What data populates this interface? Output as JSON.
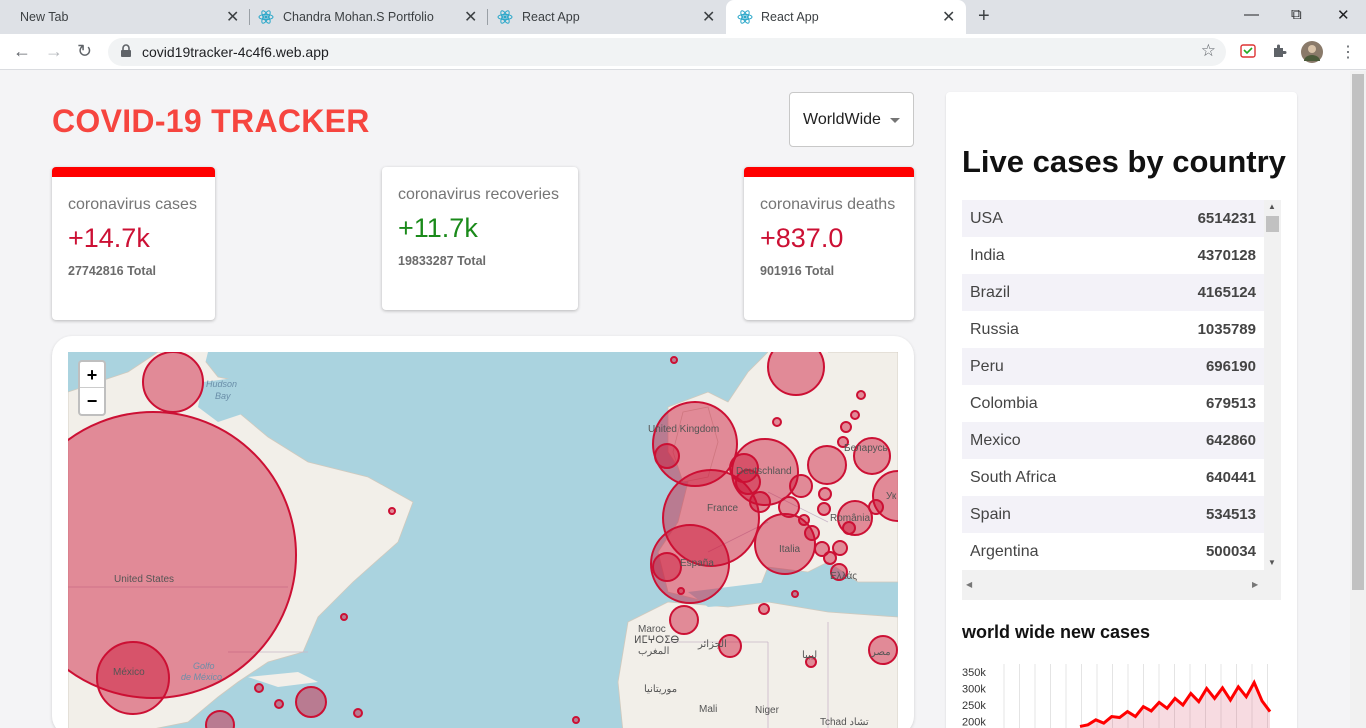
{
  "browser": {
    "tabs": [
      {
        "label": "New Tab",
        "icon": "none"
      },
      {
        "label": "Chandra Mohan.S Portfolio",
        "icon": "react-icon"
      },
      {
        "label": "React App",
        "icon": "react-icon"
      },
      {
        "label": "React App",
        "icon": "react-icon",
        "active": true
      }
    ],
    "url": "covid19tracker-4c4f6.web.app"
  },
  "header": {
    "title": "COVID-19 TRACKER",
    "country_select": "WorldWide"
  },
  "cards": [
    {
      "title": "coronavirus cases",
      "value": "+14.7k",
      "total": "27742816 Total",
      "selected": true
    },
    {
      "title": "coronavirus recoveries",
      "value": "+11.7k",
      "total": "19833287 Total",
      "selected": false
    },
    {
      "title": "coronavirus deaths",
      "value": "+837.0",
      "total": "901916 Total",
      "selected": true
    }
  ],
  "map": {
    "zoom_in": "+",
    "zoom_out": "−",
    "labels": {
      "hudson": "Hudson",
      "bay": "Bay",
      "united_states": "United States",
      "mexico": "México",
      "golfo": "Golfo",
      "de_mexico": "de México",
      "united_kingdom": "United Kingdom",
      "deutschland": "Deutschland",
      "france": "France",
      "espana": "España",
      "italia": "Italia",
      "romania": "România",
      "belarus": "Беларусь",
      "ukr": "Ук",
      "ellas": "Ελλάς",
      "maroc": "Maroc",
      "maroc_tifinagh": "ⵍⵎⵖⵔⵉⴱ",
      "maroc_ar": "المغرب",
      "algeria": "الجزائر",
      "libya": "ليبيا",
      "mauritania": "موريتانيا",
      "mali": "Mali",
      "niger": "Niger",
      "tchad": "Tchad تشاد",
      "misr": "مصر"
    }
  },
  "sidebar": {
    "title": "Live cases by country",
    "countries": [
      {
        "country": "USA",
        "cases": "6514231"
      },
      {
        "country": "India",
        "cases": "4370128"
      },
      {
        "country": "Brazil",
        "cases": "4165124"
      },
      {
        "country": "Russia",
        "cases": "1035789"
      },
      {
        "country": "Peru",
        "cases": "696190"
      },
      {
        "country": "Colombia",
        "cases": "679513"
      },
      {
        "country": "Mexico",
        "cases": "642860"
      },
      {
        "country": "South Africa",
        "cases": "640441"
      },
      {
        "country": "Spain",
        "cases": "534513"
      },
      {
        "country": "Argentina",
        "cases": "500034"
      }
    ],
    "chart_title": "world wide new cases"
  },
  "chart_data": {
    "type": "line",
    "title": "world wide new cases",
    "y_ticks": [
      "350k",
      "300k",
      "250k",
      "200k"
    ],
    "ylim": [
      200000,
      350000
    ],
    "color": "#ff0000",
    "values": [
      185000,
      190000,
      205000,
      195000,
      215000,
      212000,
      230000,
      215000,
      245000,
      232000,
      258000,
      240000,
      270000,
      250000,
      285000,
      260000,
      300000,
      270000,
      302000,
      265000,
      305000,
      275000,
      318000,
      262000,
      230000
    ]
  }
}
